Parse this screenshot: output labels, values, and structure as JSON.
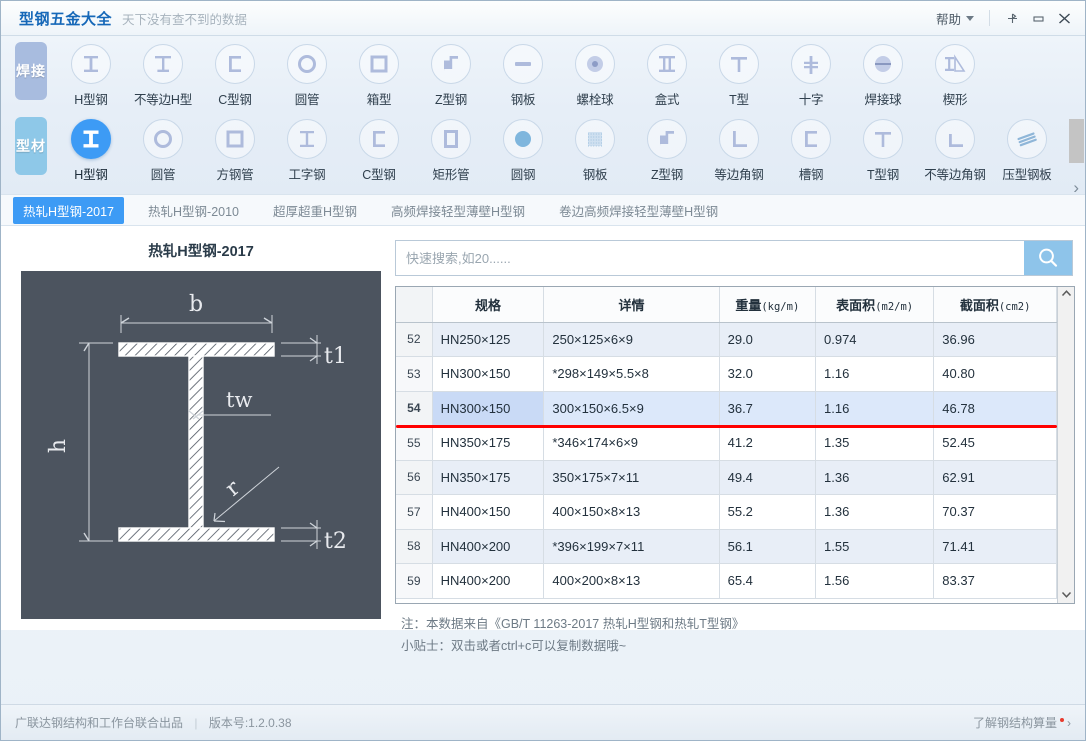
{
  "titlebar": {
    "app_title": "型钢五金大全",
    "subtitle": "天下没有查不到的数据",
    "help_label": "帮助",
    "pin_icon": "pin-icon",
    "minimize_icon": "minimize-icon",
    "close_icon": "close-icon"
  },
  "ribbon": {
    "group_weld": "焊接",
    "group_section": "型材",
    "next_arrow": "›",
    "row1": [
      {
        "label": "H型钢",
        "icon": "h-beam-icon"
      },
      {
        "label": "不等边H型",
        "icon": "unequal-h-beam-icon"
      },
      {
        "label": "C型钢",
        "icon": "c-channel-icon"
      },
      {
        "label": "圆管",
        "icon": "round-tube-icon"
      },
      {
        "label": "箱型",
        "icon": "box-section-icon"
      },
      {
        "label": "Z型钢",
        "icon": "z-section-icon"
      },
      {
        "label": "钢板",
        "icon": "steel-plate-icon"
      },
      {
        "label": "螺栓球",
        "icon": "bolt-ball-icon"
      },
      {
        "label": "盒式",
        "icon": "box-type-icon"
      },
      {
        "label": "T型",
        "icon": "t-section-icon"
      },
      {
        "label": "十字",
        "icon": "cross-section-icon"
      },
      {
        "label": "焊接球",
        "icon": "welded-ball-icon"
      },
      {
        "label": "楔形",
        "icon": "wedge-icon"
      }
    ],
    "row2": [
      {
        "label": "H型钢",
        "icon": "h-beam-icon",
        "active": true
      },
      {
        "label": "圆管",
        "icon": "round-tube-icon"
      },
      {
        "label": "方钢管",
        "icon": "square-tube-icon"
      },
      {
        "label": "工字钢",
        "icon": "i-beam-icon"
      },
      {
        "label": "C型钢",
        "icon": "c-channel-icon"
      },
      {
        "label": "矩形管",
        "icon": "rect-tube-icon"
      },
      {
        "label": "圆钢",
        "icon": "round-bar-icon"
      },
      {
        "label": "钢板",
        "icon": "steel-plate-icon"
      },
      {
        "label": "Z型钢",
        "icon": "z-section-icon"
      },
      {
        "label": "等边角钢",
        "icon": "equal-angle-icon"
      },
      {
        "label": "槽钢",
        "icon": "channel-icon"
      },
      {
        "label": "T型钢",
        "icon": "t-beam-icon"
      },
      {
        "label": "不等边角钢",
        "icon": "unequal-angle-icon"
      },
      {
        "label": "压型钢板",
        "icon": "profiled-plate-icon"
      }
    ]
  },
  "subtabs": [
    {
      "label": "热轧H型钢-2017",
      "active": true
    },
    {
      "label": "热轧H型钢-2010",
      "active": false
    },
    {
      "label": "超厚超重H型钢",
      "active": false
    },
    {
      "label": "高频焊接轻型薄壁H型钢",
      "active": false
    },
    {
      "label": "卷边高频焊接轻型薄壁H型钢",
      "active": false
    }
  ],
  "diagram": {
    "title": "热轧H型钢-2017",
    "labels": {
      "b": "b",
      "h": "h",
      "t1": "t1",
      "t2": "t2",
      "tw": "tw",
      "r": "r"
    }
  },
  "search": {
    "placeholder": "快速搜索,如20......",
    "value": "",
    "icon": "search-icon"
  },
  "table": {
    "columns": [
      {
        "key": "idx",
        "label": "",
        "unit": ""
      },
      {
        "key": "spec",
        "label": "规格",
        "unit": ""
      },
      {
        "key": "detail",
        "label": "详情",
        "unit": ""
      },
      {
        "key": "weight",
        "label": "重量",
        "unit": "(kg/m)"
      },
      {
        "key": "surface",
        "label": "表面积",
        "unit": "(m2/m)"
      },
      {
        "key": "area",
        "label": "截面积",
        "unit": "(cm2)"
      }
    ],
    "rows": [
      {
        "idx": "52",
        "spec": "HN250×125",
        "detail": "250×125×6×9",
        "weight": "29.0",
        "surface": "0.974",
        "area": "36.96",
        "selected": false
      },
      {
        "idx": "53",
        "spec": "HN300×150",
        "detail": "*298×149×5.5×8",
        "weight": "32.0",
        "surface": "1.16",
        "area": "40.80",
        "selected": false
      },
      {
        "idx": "54",
        "spec": "HN300×150",
        "detail": "300×150×6.5×9",
        "weight": "36.7",
        "surface": "1.16",
        "area": "46.78",
        "selected": true
      },
      {
        "idx": "55",
        "spec": "HN350×175",
        "detail": "*346×174×6×9",
        "weight": "41.2",
        "surface": "1.35",
        "area": "52.45",
        "selected": false
      },
      {
        "idx": "56",
        "spec": "HN350×175",
        "detail": "350×175×7×11",
        "weight": "49.4",
        "surface": "1.36",
        "area": "62.91",
        "selected": false
      },
      {
        "idx": "57",
        "spec": "HN400×150",
        "detail": "400×150×8×13",
        "weight": "55.2",
        "surface": "1.36",
        "area": "70.37",
        "selected": false
      },
      {
        "idx": "58",
        "spec": "HN400×200",
        "detail": "*396×199×7×11",
        "weight": "56.1",
        "surface": "1.55",
        "area": "71.41",
        "selected": false
      },
      {
        "idx": "59",
        "spec": "HN400×200",
        "detail": "400×200×8×13",
        "weight": "65.4",
        "surface": "1.56",
        "area": "83.37",
        "selected": false
      }
    ]
  },
  "notes": {
    "line1": "注：本数据来自《GB/T 11263-2017 热轧H型钢和热轧T型钢》",
    "line2": "小贴士：双击或者ctrl+c可以复制数据哦~"
  },
  "statusbar": {
    "producer": "广联达钢结构和工作台联合出品",
    "separator": "|",
    "version": "版本号:1.2.0.38",
    "link": "了解钢结构算量",
    "link_arrow": "›"
  },
  "colors": {
    "accent": "#3d9bf5",
    "brand_title": "#1668b8",
    "selected_row": "#dce8fa",
    "highlight_underline": "#ff0000",
    "diagram_bg": "#4c545f",
    "weld_tab": "#a8bcdf",
    "section_tab": "#8ec8e8"
  }
}
